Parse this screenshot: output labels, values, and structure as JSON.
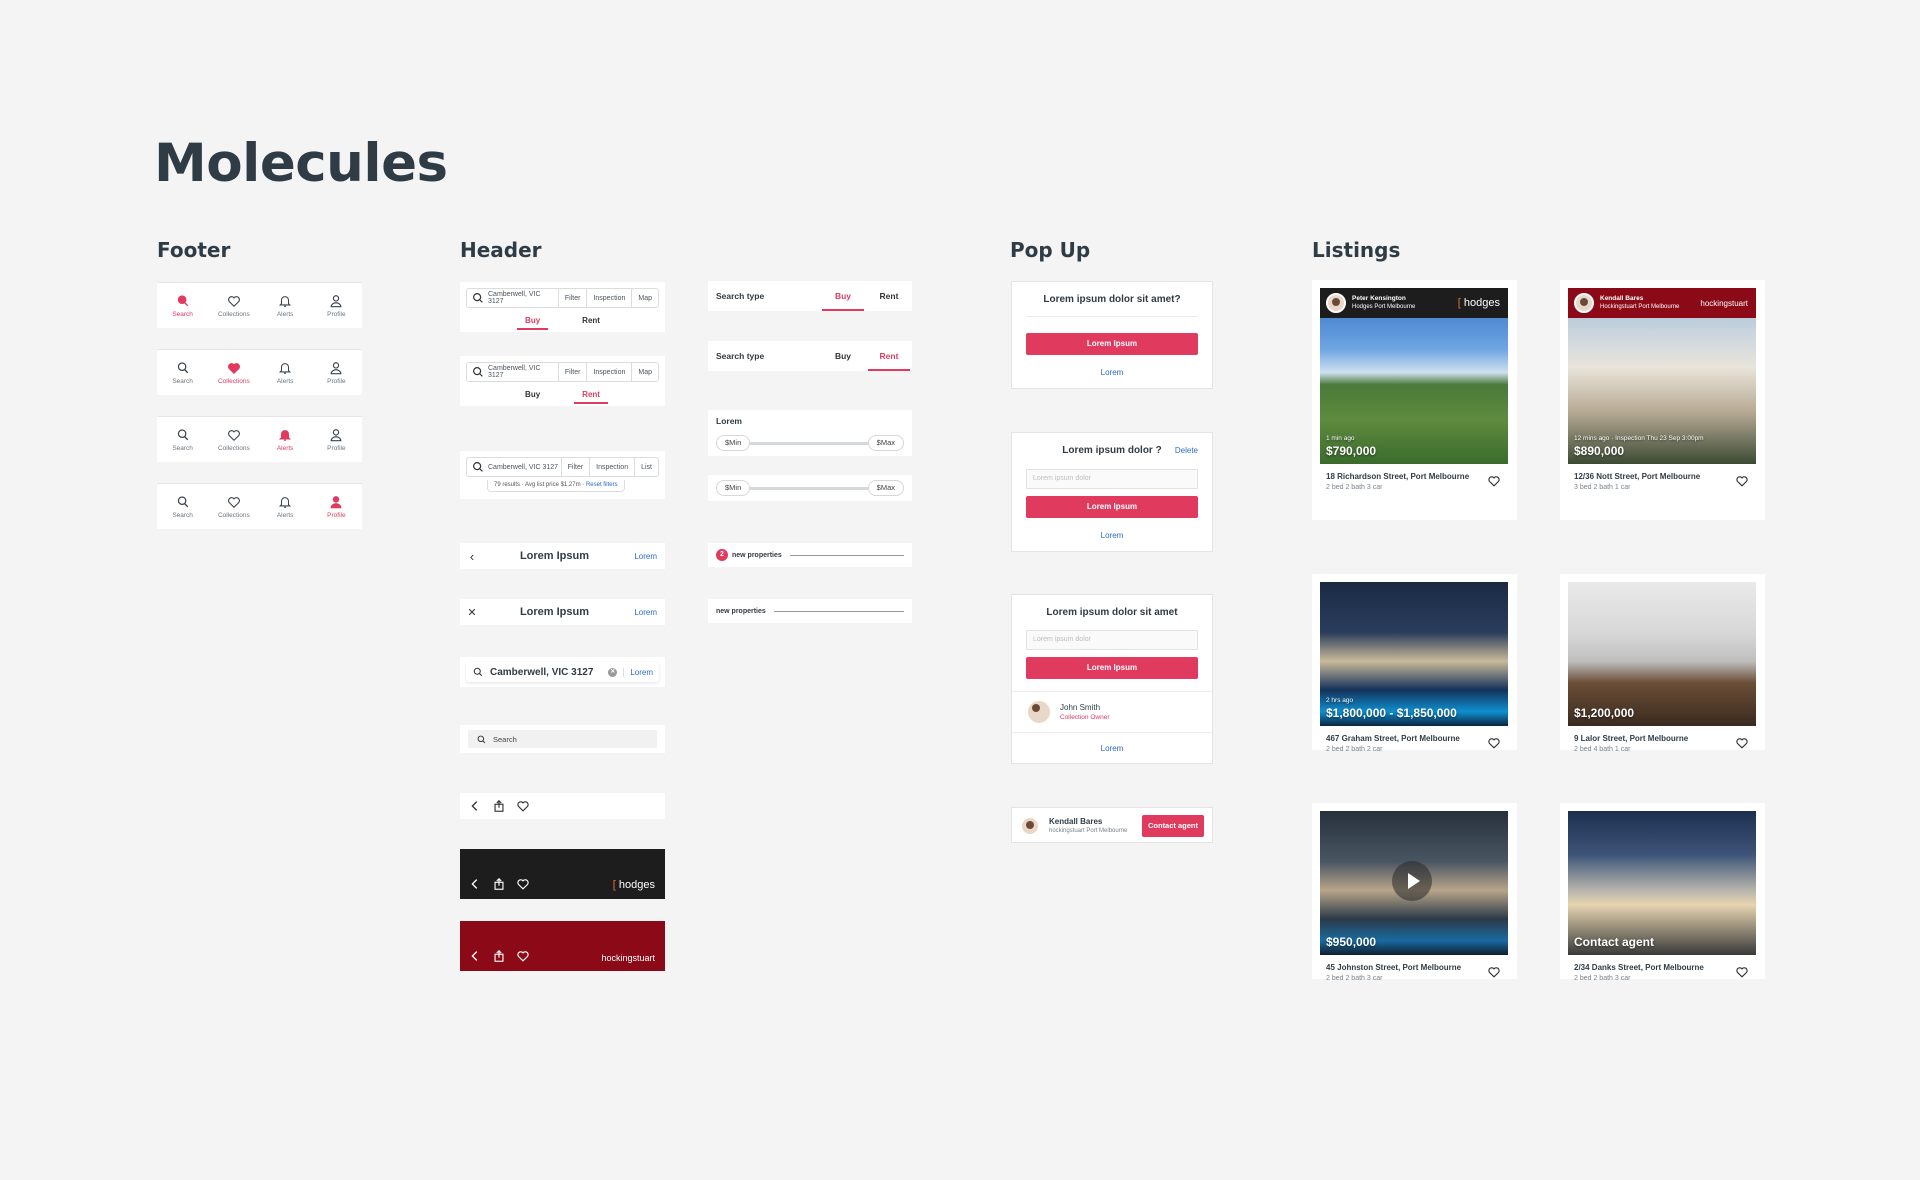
{
  "page_title": "Molecules",
  "sections": {
    "footer": "Footer",
    "header": "Header",
    "popup": "Pop Up",
    "listings": "Listings"
  },
  "footer_nav": {
    "items": [
      "Search",
      "Collections",
      "Alerts",
      "Profile"
    ]
  },
  "header": {
    "search_location": "Camberwell, VIC 3127",
    "filter": "Filter",
    "inspection": "Inspection",
    "map": "Map",
    "list": "List",
    "buy": "Buy",
    "rent": "Rent",
    "results_text": "79 results · Avg list price $1.27m ·",
    "reset_filters": "Reset filters",
    "nav_title": "Lorem Ipsum",
    "nav_action": "Lorem",
    "search_placeholder": "Search",
    "brand_hodges": "hodges",
    "brand_hocking": "hockingstuart",
    "search_type_label": "Search type",
    "slider_label": "Lorem",
    "min": "$Min",
    "max": "$Max",
    "new_count": "2",
    "new_properties": "new properties"
  },
  "popups": {
    "p1_title": "Lorem ipsum dolor sit amet?",
    "p1_button": "Lorem Ipsum",
    "p1_link": "Lorem",
    "p2_title": "Lorem ipsum dolor ?",
    "p2_delete": "Delete",
    "p2_placeholder": "Lorem ipsum dolor",
    "p2_button": "Lorem Ipsum",
    "p2_link": "Lorem",
    "p3_title": "Lorem ipsum dolor sit amet",
    "p3_placeholder": "Lorem ipsum dolor",
    "p3_button": "Lorem Ipsum",
    "p3_user": "John Smith",
    "p3_role": "Collection Owner",
    "p3_link": "Lorem",
    "agent_name": "Kendall Bares",
    "agent_office": "hockingstuart Port Melbourne",
    "contact_button": "Contact agent"
  },
  "listings": [
    {
      "agent": "Peter Kensington",
      "office": "Hodges Port Melbourne",
      "logo": "hodges",
      "meta": "1 min ago",
      "price": "$790,000",
      "address": "18 Richardson Street, Port Melbourne",
      "specs": "2 bed  2 bath  3 car"
    },
    {
      "agent": "Kendall Bares",
      "office": "Hockingstuart Port Melbourne",
      "logo": "hockingstuart",
      "meta": "12 mins ago · Inspection Thu 23 Sep 3:00pm",
      "price": "$890,000",
      "address": "12/36 Nott Street, Port Melbourne",
      "specs": "3 bed  2 bath  1 car"
    },
    {
      "meta": "2 hrs ago",
      "price": "$1,800,000 - $1,850,000",
      "address": "467 Graham Street, Port Melbourne",
      "specs": "2 bed  2 bath  2 car"
    },
    {
      "meta": "",
      "price": "$1,200,000",
      "address": "9 Lalor Street, Port Melbourne",
      "specs": "2 bed  4 bath  1 car"
    },
    {
      "meta": "",
      "price": "$950,000",
      "address": "45 Johnston Street, Port Melbourne",
      "specs": "2 bed  2 bath  3 car"
    },
    {
      "meta": "",
      "price": "Contact agent",
      "address": "2/34 Danks Street, Port Melbourne",
      "specs": "2 bed  2 bath  3 car"
    }
  ]
}
